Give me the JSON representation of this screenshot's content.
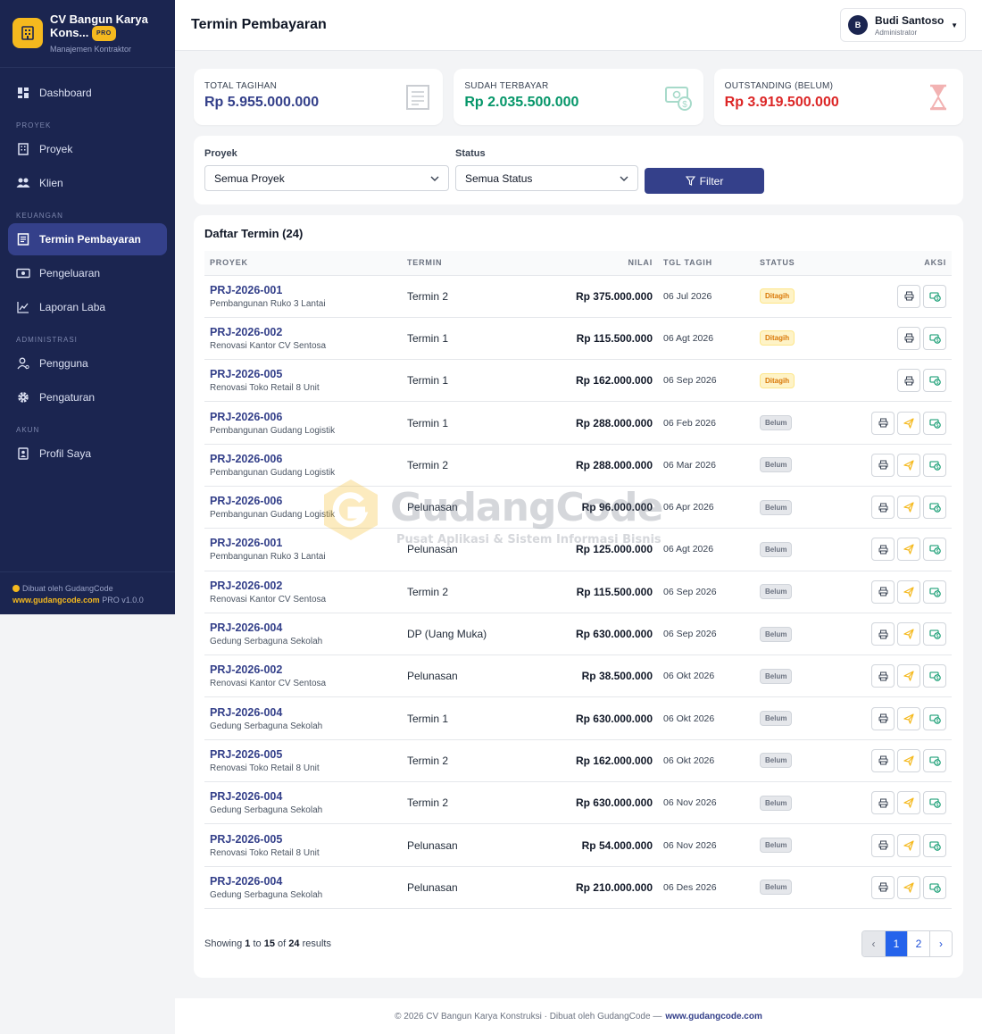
{
  "brand": {
    "name": "CV Bangun Karya Kons...",
    "pro": "PRO",
    "subtitle": "Manajemen Kontraktor"
  },
  "nav": {
    "dashboard": "Dashboard",
    "section_proyek": "PROYEK",
    "proyek": "Proyek",
    "klien": "Klien",
    "section_keuangan": "KEUANGAN",
    "termin": "Termin Pembayaran",
    "pengeluaran": "Pengeluaran",
    "laporan": "Laporan Laba",
    "section_admin": "ADMINISTRASI",
    "pengguna": "Pengguna",
    "pengaturan": "Pengaturan",
    "section_akun": "AKUN",
    "profil": "Profil Saya"
  },
  "sidebar_footer": {
    "made_by": "Dibuat oleh GudangCode",
    "site": "www.gudangcode.com",
    "version": "PRO v1.0.0"
  },
  "header": {
    "title": "Termin Pembayaran",
    "user_initial": "B",
    "user_name": "Budi Santoso",
    "user_role": "Administrator"
  },
  "summary": {
    "total_label": "TOTAL TAGIHAN",
    "total_value": "Rp 5.955.000.000",
    "paid_label": "SUDAH TERBAYAR",
    "paid_value": "Rp 2.035.500.000",
    "outstanding_label": "OUTSTANDING (BELUM)",
    "outstanding_value": "Rp 3.919.500.000"
  },
  "colors": {
    "navy": "#1b2550",
    "accent": "#34408a",
    "gold": "#f5b91e",
    "paid_green": "#059669",
    "outstanding_red": "#dc2626"
  },
  "filters": {
    "proyek_label": "Proyek",
    "proyek_value": "Semua Proyek",
    "status_label": "Status",
    "status_value": "Semua Status",
    "button": "Filter"
  },
  "table": {
    "title": "Daftar Termin (24)",
    "columns": {
      "proyek": "PROYEK",
      "termin": "TERMIN",
      "nilai": "NILAI",
      "tgl": "TGL TAGIH",
      "status": "STATUS",
      "aksi": "AKSI"
    },
    "rows": [
      {
        "code": "PRJ-2026-001",
        "name": "Pembangunan Ruko 3 Lantai",
        "termin": "Termin 2",
        "nilai": "Rp 375.000.000",
        "tgl": "06 Jul 2026",
        "status": "Ditagih"
      },
      {
        "code": "PRJ-2026-002",
        "name": "Renovasi Kantor CV Sentosa",
        "termin": "Termin 1",
        "nilai": "Rp 115.500.000",
        "tgl": "06 Agt 2026",
        "status": "Ditagih"
      },
      {
        "code": "PRJ-2026-005",
        "name": "Renovasi Toko Retail 8 Unit",
        "termin": "Termin 1",
        "nilai": "Rp 162.000.000",
        "tgl": "06 Sep 2026",
        "status": "Ditagih"
      },
      {
        "code": "PRJ-2026-006",
        "name": "Pembangunan Gudang Logistik",
        "termin": "Termin 1",
        "nilai": "Rp 288.000.000",
        "tgl": "06 Feb 2026",
        "status": "Belum"
      },
      {
        "code": "PRJ-2026-006",
        "name": "Pembangunan Gudang Logistik",
        "termin": "Termin 2",
        "nilai": "Rp 288.000.000",
        "tgl": "06 Mar 2026",
        "status": "Belum"
      },
      {
        "code": "PRJ-2026-006",
        "name": "Pembangunan Gudang Logistik",
        "termin": "Pelunasan",
        "nilai": "Rp 96.000.000",
        "tgl": "06 Apr 2026",
        "status": "Belum"
      },
      {
        "code": "PRJ-2026-001",
        "name": "Pembangunan Ruko 3 Lantai",
        "termin": "Pelunasan",
        "nilai": "Rp 125.000.000",
        "tgl": "06 Agt 2026",
        "status": "Belum"
      },
      {
        "code": "PRJ-2026-002",
        "name": "Renovasi Kantor CV Sentosa",
        "termin": "Termin 2",
        "nilai": "Rp 115.500.000",
        "tgl": "06 Sep 2026",
        "status": "Belum"
      },
      {
        "code": "PRJ-2026-004",
        "name": "Gedung Serbaguna Sekolah",
        "termin": "DP (Uang Muka)",
        "nilai": "Rp 630.000.000",
        "tgl": "06 Sep 2026",
        "status": "Belum"
      },
      {
        "code": "PRJ-2026-002",
        "name": "Renovasi Kantor CV Sentosa",
        "termin": "Pelunasan",
        "nilai": "Rp 38.500.000",
        "tgl": "06 Okt 2026",
        "status": "Belum"
      },
      {
        "code": "PRJ-2026-004",
        "name": "Gedung Serbaguna Sekolah",
        "termin": "Termin 1",
        "nilai": "Rp 630.000.000",
        "tgl": "06 Okt 2026",
        "status": "Belum"
      },
      {
        "code": "PRJ-2026-005",
        "name": "Renovasi Toko Retail 8 Unit",
        "termin": "Termin 2",
        "nilai": "Rp 162.000.000",
        "tgl": "06 Okt 2026",
        "status": "Belum"
      },
      {
        "code": "PRJ-2026-004",
        "name": "Gedung Serbaguna Sekolah",
        "termin": "Termin 2",
        "nilai": "Rp 630.000.000",
        "tgl": "06 Nov 2026",
        "status": "Belum"
      },
      {
        "code": "PRJ-2026-005",
        "name": "Renovasi Toko Retail 8 Unit",
        "termin": "Pelunasan",
        "nilai": "Rp 54.000.000",
        "tgl": "06 Nov 2026",
        "status": "Belum"
      },
      {
        "code": "PRJ-2026-004",
        "name": "Gedung Serbaguna Sekolah",
        "termin": "Pelunasan",
        "nilai": "Rp 210.000.000",
        "tgl": "06 Des 2026",
        "status": "Belum"
      }
    ]
  },
  "pagination": {
    "showing_prefix": "Showing",
    "from": "1",
    "to_word": "to",
    "to": "15",
    "of_word": "of",
    "total": "24",
    "results_word": "results",
    "prev": "‹",
    "pages": [
      "1",
      "2"
    ],
    "next": "›"
  },
  "footer": {
    "text": "© 2026 CV Bangun Karya Konstruksi · Dibuat oleh GudangCode —",
    "link": "www.gudangcode.com"
  },
  "watermark": {
    "title": "GudangCode",
    "subtitle": "Pusat Aplikasi & Sistem Informasi Bisnis"
  }
}
